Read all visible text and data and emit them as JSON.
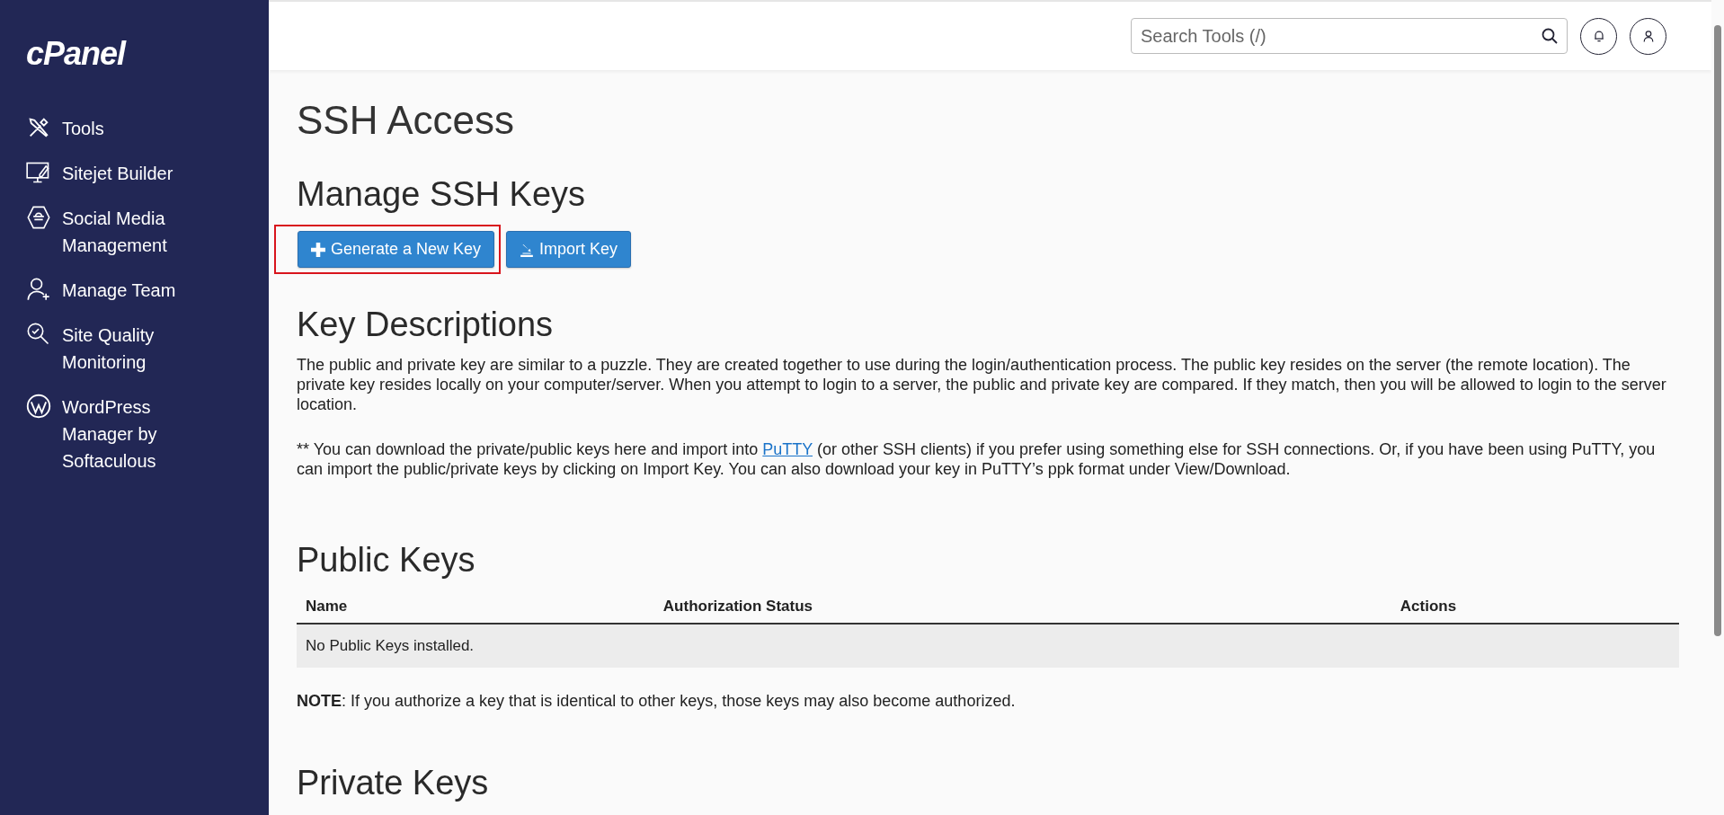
{
  "sidebar": {
    "logo": "cPanel",
    "items": [
      {
        "label": "Tools"
      },
      {
        "label": "Sitejet Builder"
      },
      {
        "label": "Social Media Management"
      },
      {
        "label": "Manage Team"
      },
      {
        "label": "Site Quality Monitoring"
      },
      {
        "label": "WordPress Manager by Softaculous"
      }
    ]
  },
  "header": {
    "search": {
      "placeholder": "Search Tools (/)"
    }
  },
  "page_title": "SSH Access",
  "manage": {
    "heading": "Manage SSH Keys",
    "buttons": [
      {
        "label": "Generate a New Key",
        "highlighted": true
      },
      {
        "label": "Import Key",
        "highlighted": false
      }
    ]
  },
  "descriptions": {
    "heading": "Key Descriptions",
    "paragraph": "The public and private key are similar to a puzzle. They are created together to use during the login/authentication process. The public key resides on the server (the remote location). The private key resides locally on your computer/server. When you attempt to login to a server, the public and private key are compared. If they match, then you will be allowed to login to the server location.",
    "note_before": "** You can download the private/public keys here and import into",
    "note_link": "PuTTY",
    "note_after": "(or other SSH clients) if you prefer using something else for SSH connections. Or, if you have been using PuTTY, you can import the public/private keys by clicking on Import Key. You can also download your key in PuTTY’s ppk format under View/Download."
  },
  "public_keys": {
    "heading": "Public Keys",
    "columns": [
      "Name",
      "Authorization Status",
      "Actions"
    ],
    "empty_message": "No Public Keys installed.",
    "note": "**NOTE**: If you authorize a key that is identical to other keys, those keys may also become authorized."
  },
  "private_keys": {
    "heading": "Private Keys"
  }
}
